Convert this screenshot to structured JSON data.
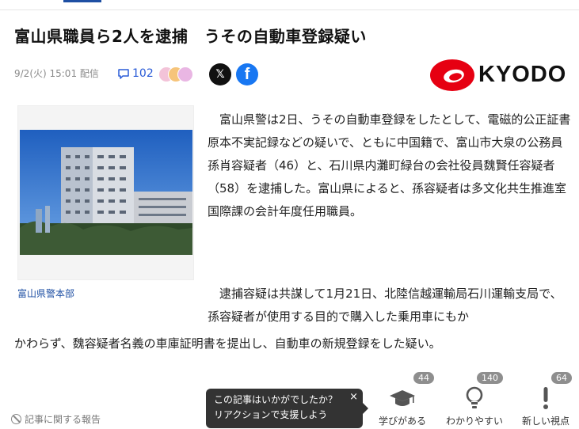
{
  "article": {
    "title": "富山県職員ら2人を逮捕　うその自動車登録疑い",
    "date": "9/2(火) 15:01",
    "delivery_label": "配信",
    "comment_count": "102",
    "publisher": "KYODO",
    "photo_caption": "富山県警本部",
    "paragraph1": "　富山県警は2日、うその自動車登録をしたとして、電磁的公正証書原本不実記録などの疑いで、ともに中国籍で、富山市大泉の公務員孫肖容疑者（46）と、石川県内灘町緑台の会社役員魏賢任容疑者（58）を逮捕した。富山県によると、孫容疑者は多文化共生推進室国際課の会計年度任用職員。",
    "paragraph2_part1": "　逮捕容疑は共謀して1月21日、北陸信越運輸局石川運輸支局で、孫容疑者が使用する目的で購入した乗用車にもか",
    "paragraph2_part2": "かわらず、魏容疑者名義の車庫証明書を提出し、自動車の新規登録をした疑い。"
  },
  "share": {
    "x_icon": "x-logo-icon",
    "facebook_icon": "facebook-logo-icon",
    "x_label": "𝕏",
    "facebook_label": "f"
  },
  "footer": {
    "report_label": "記事に関する報告",
    "tooltip_line1": "この記事はいかがでしたか？",
    "tooltip_line2": "リアクションで支援しよう",
    "tooltip_close": "×"
  },
  "reactions": [
    {
      "label": "学びがある",
      "count": "44",
      "icon": "graduation-cap-icon"
    },
    {
      "label": "わかりやすい",
      "count": "140",
      "icon": "lightbulb-icon"
    },
    {
      "label": "新しい視点",
      "count": "64",
      "icon": "exclamation-icon"
    }
  ],
  "colors": {
    "accent": "#1e4fa3",
    "link": "#2a5bd7",
    "kyodo_red": "#e60012",
    "facebook": "#1877f2"
  }
}
